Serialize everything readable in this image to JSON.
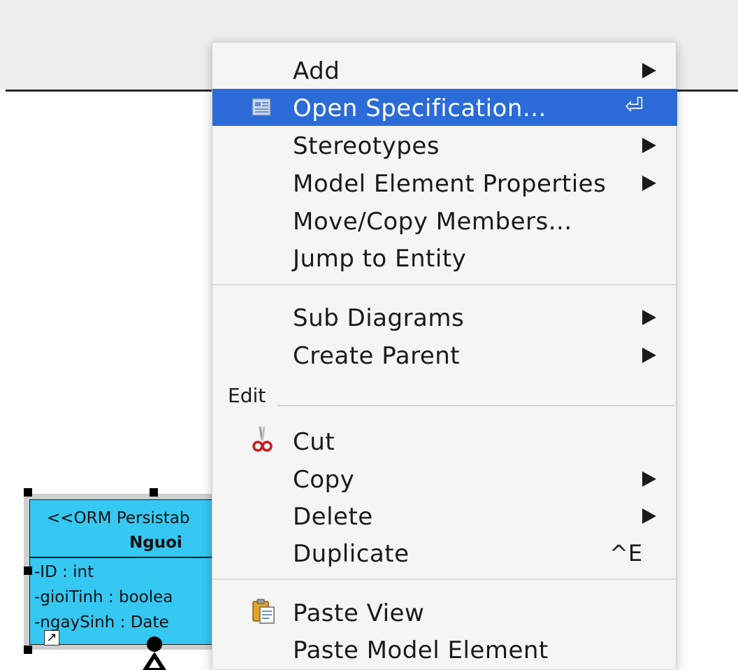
{
  "class_element": {
    "stereotype": "<<ORM Persistab",
    "name": "Nguoi",
    "attributes": [
      "-ID : int",
      "-gioiTinh : boolea",
      "-ngaySinh : Date"
    ],
    "fill_color": "#35c8f2"
  },
  "context_menu": {
    "highlight_color": "#2a6bd8",
    "items_top": [
      {
        "label": "Add",
        "submenu": true
      },
      {
        "label": "Open Specification...",
        "icon": "specification-icon",
        "accelerator": "⏎",
        "highlighted": true
      },
      {
        "label": "Stereotypes",
        "submenu": true
      },
      {
        "label": "Model Element Properties",
        "submenu": true
      },
      {
        "label": "Move/Copy Members..."
      },
      {
        "label": "Jump to Entity"
      }
    ],
    "items_diagram": [
      {
        "label": "Sub Diagrams",
        "submenu": true
      },
      {
        "label": "Create Parent",
        "submenu": true
      }
    ],
    "edit_group_title": "Edit",
    "items_edit": [
      {
        "label": "Cut",
        "icon": "scissors-icon"
      },
      {
        "label": "Copy",
        "submenu": true
      },
      {
        "label": "Delete",
        "submenu": true
      },
      {
        "label": "Duplicate",
        "accelerator": "^E"
      }
    ],
    "items_paste": [
      {
        "label": "Paste View",
        "icon": "clipboard-icon"
      },
      {
        "label": "Paste Model Element"
      }
    ]
  }
}
